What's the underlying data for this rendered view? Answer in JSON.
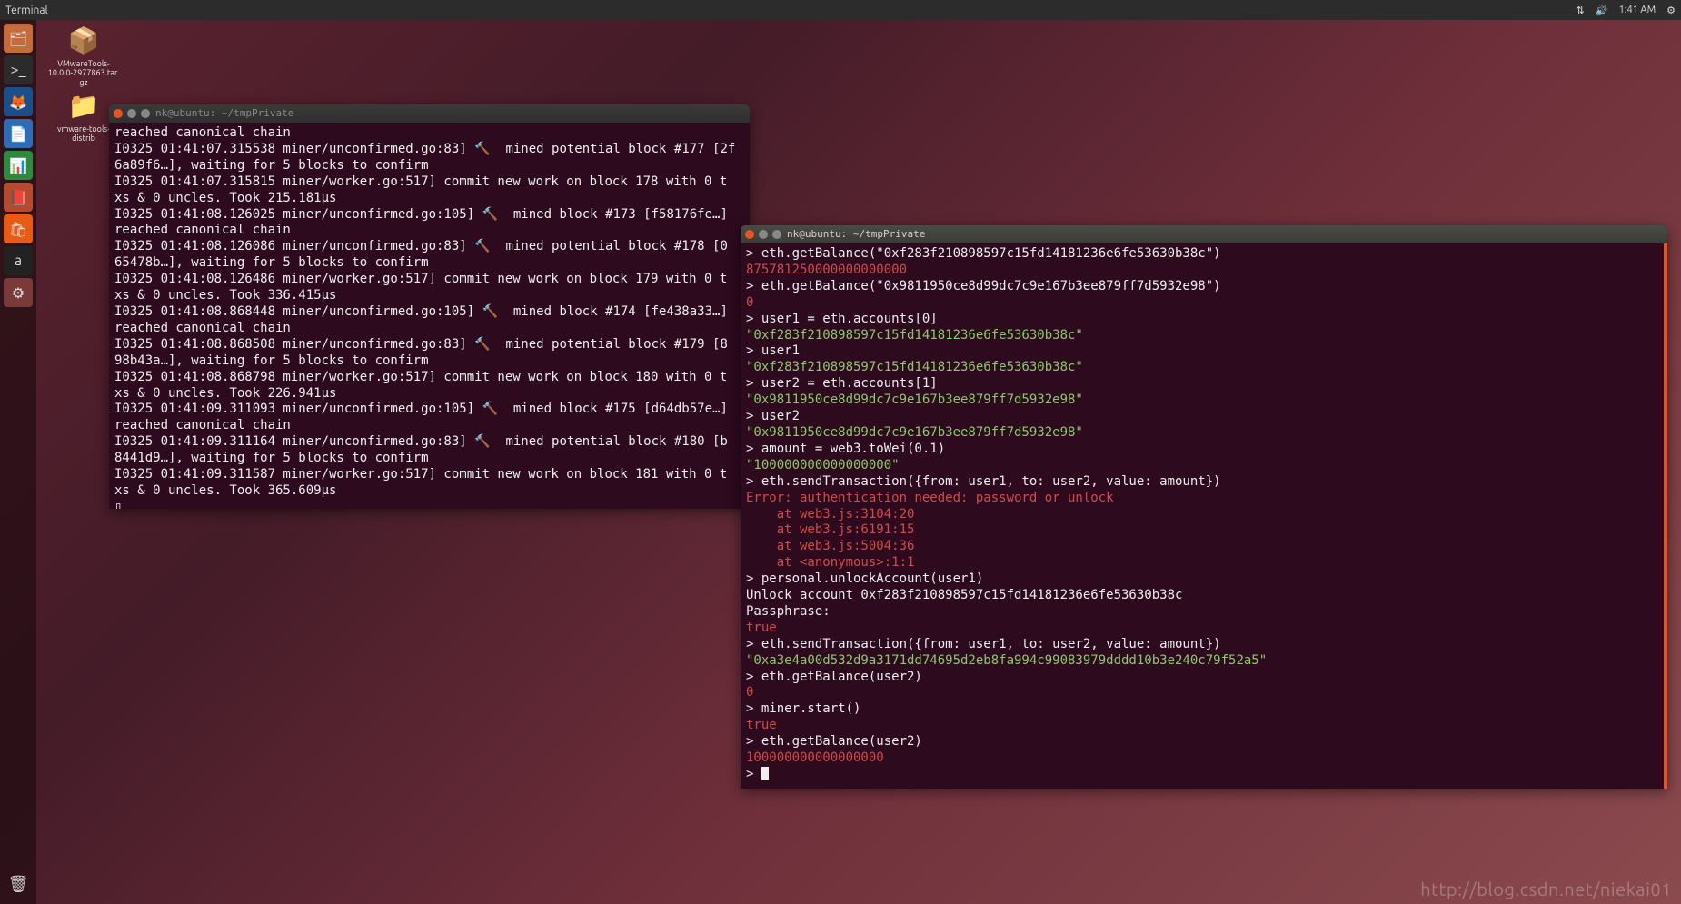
{
  "topbar": {
    "app": "Terminal",
    "time": "1:41 AM"
  },
  "desktop": {
    "icon1": {
      "glyph": "📦",
      "label": "VMwareTools-\n10.0.0-2977863.tar.\ngz"
    },
    "icon2": {
      "glyph": "📁",
      "label": "vmware-tools-\ndistrib"
    }
  },
  "term1": {
    "title": "nk@ubuntu: ~/tmpPrivate",
    "lines": [
      {
        "t": "reached canonical chain"
      },
      {
        "t": "I0325 01:41:07.315538 miner/unconfirmed.go:83] 🔨  mined potential block #177 [2f"
      },
      {
        "t": "6a89f6…], waiting for 5 blocks to confirm"
      },
      {
        "t": "I0325 01:41:07.315815 miner/worker.go:517] commit new work on block 178 with 0 t"
      },
      {
        "t": "xs & 0 uncles. Took 215.181µs"
      },
      {
        "t": "I0325 01:41:08.126025 miner/unconfirmed.go:105] 🔨  mined block #173 [f58176fe…]"
      },
      {
        "t": "reached canonical chain"
      },
      {
        "t": "I0325 01:41:08.126086 miner/unconfirmed.go:83] 🔨  mined potential block #178 [0"
      },
      {
        "t": "65478b…], waiting for 5 blocks to confirm"
      },
      {
        "t": "I0325 01:41:08.126486 miner/worker.go:517] commit new work on block 179 with 0 t"
      },
      {
        "t": "xs & 0 uncles. Took 336.415µs"
      },
      {
        "t": "I0325 01:41:08.868448 miner/unconfirmed.go:105] 🔨  mined block #174 [fe438a33…]"
      },
      {
        "t": "reached canonical chain"
      },
      {
        "t": "I0325 01:41:08.868508 miner/unconfirmed.go:83] 🔨  mined potential block #179 [8"
      },
      {
        "t": "98b43a…], waiting for 5 blocks to confirm"
      },
      {
        "t": "I0325 01:41:08.868798 miner/worker.go:517] commit new work on block 180 with 0 t"
      },
      {
        "t": "xs & 0 uncles. Took 226.941µs"
      },
      {
        "t": "I0325 01:41:09.311093 miner/unconfirmed.go:105] 🔨  mined block #175 [d64db57e…]"
      },
      {
        "t": "reached canonical chain"
      },
      {
        "t": "I0325 01:41:09.311164 miner/unconfirmed.go:83] 🔨  mined potential block #180 [b"
      },
      {
        "t": "8441d9…], waiting for 5 blocks to confirm"
      },
      {
        "t": "I0325 01:41:09.311587 miner/worker.go:517] commit new work on block 181 with 0 t"
      },
      {
        "t": "xs & 0 uncles. Took 365.609µs"
      },
      {
        "t": "▯"
      }
    ]
  },
  "term2": {
    "title": "nk@ubuntu: ~/tmpPrivate",
    "lines": [
      {
        "t": "> eth.getBalance(\"0xf283f210898597c15fd14181236e6fe53630b38c\")"
      },
      {
        "c": "red",
        "t": "875781250000000000000"
      },
      {
        "t": "> eth.getBalance(\"0x9811950ce8d99dc7c9e167b3ee879ff7d5932e98\")"
      },
      {
        "c": "red",
        "t": "0"
      },
      {
        "t": "> user1 = eth.accounts[0]"
      },
      {
        "c": "green",
        "t": "\"0xf283f210898597c15fd14181236e6fe53630b38c\""
      },
      {
        "t": "> user1"
      },
      {
        "c": "green",
        "t": "\"0xf283f210898597c15fd14181236e6fe53630b38c\""
      },
      {
        "t": "> user2 = eth.accounts[1]"
      },
      {
        "c": "green",
        "t": "\"0x9811950ce8d99dc7c9e167b3ee879ff7d5932e98\""
      },
      {
        "t": "> user2"
      },
      {
        "c": "green",
        "t": "\"0x9811950ce8d99dc7c9e167b3ee879ff7d5932e98\""
      },
      {
        "t": "> amount = web3.toWei(0.1)"
      },
      {
        "c": "green",
        "t": "\"100000000000000000\""
      },
      {
        "t": "> eth.sendTransaction({from: user1, to: user2, value: amount})"
      },
      {
        "c": "red",
        "t": "Error: authentication needed: password or unlock"
      },
      {
        "c": "red",
        "t": "    at web3.js:3104:20"
      },
      {
        "c": "red",
        "t": "    at web3.js:6191:15"
      },
      {
        "c": "red",
        "t": "    at web3.js:5004:36"
      },
      {
        "c": "red",
        "t": "    at <anonymous>:1:1"
      },
      {
        "t": ""
      },
      {
        "t": "> personal.unlockAccount(user1)"
      },
      {
        "t": "Unlock account 0xf283f210898597c15fd14181236e6fe53630b38c"
      },
      {
        "t": "Passphrase:"
      },
      {
        "c": "red",
        "t": "true"
      },
      {
        "t": "> eth.sendTransaction({from: user1, to: user2, value: amount})"
      },
      {
        "c": "green",
        "t": "\"0xa3e4a00d532d9a3171dd74695d2eb8fa994c99083979dddd10b3e240c79f52a5\""
      },
      {
        "t": "> eth.getBalance(user2)"
      },
      {
        "c": "red",
        "t": "0"
      },
      {
        "t": "> miner.start()"
      },
      {
        "c": "red",
        "t": "true"
      },
      {
        "t": "> eth.getBalance(user2)"
      },
      {
        "c": "red",
        "t": "100000000000000000"
      },
      {
        "t": "> ",
        "cursor": true
      }
    ]
  },
  "launcher_icons": [
    {
      "name": "files-icon",
      "bg": "#c86b3a",
      "glyph": "🗂"
    },
    {
      "name": "terminal-icon",
      "bg": "#2b2b2b",
      "glyph": ">_"
    },
    {
      "name": "firefox-icon",
      "bg": "#1a4f8a",
      "glyph": "🦊"
    },
    {
      "name": "writer-icon",
      "bg": "#2e6db5",
      "glyph": "📄"
    },
    {
      "name": "calc-icon",
      "bg": "#2e8a3e",
      "glyph": "📊"
    },
    {
      "name": "impress-icon",
      "bg": "#b54a2e",
      "glyph": "📕"
    },
    {
      "name": "software-icon",
      "bg": "#e85b12",
      "glyph": "🛍"
    },
    {
      "name": "amazon-icon",
      "bg": "#222",
      "glyph": "a"
    },
    {
      "name": "settings-icon",
      "bg": "#7a3a3a",
      "glyph": "⚙"
    }
  ],
  "watermark": "http://blog.csdn.net/niekai01"
}
